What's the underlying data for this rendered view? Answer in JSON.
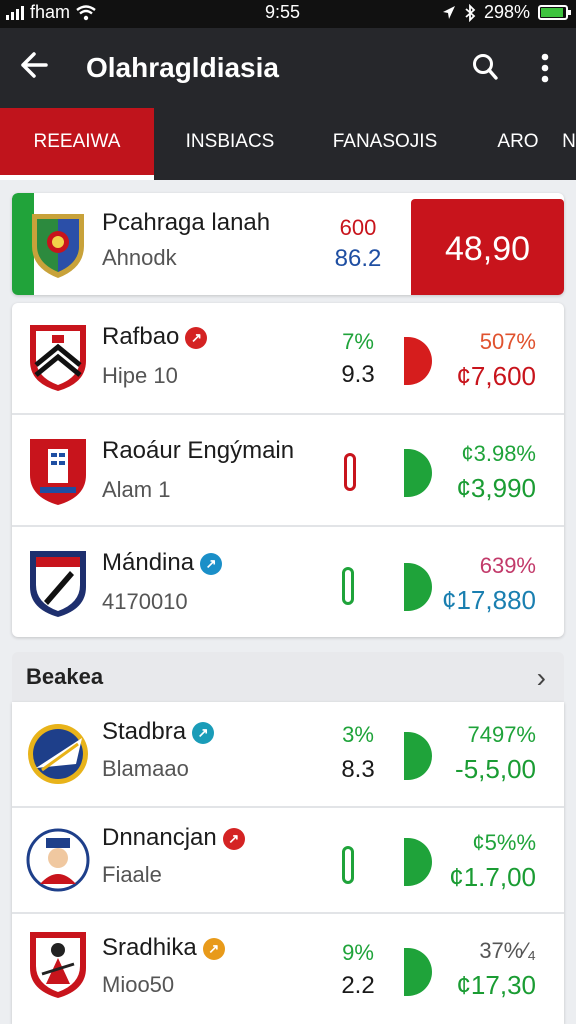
{
  "status_bar": {
    "carrier": "fham",
    "time": "9:55",
    "battery": "298%",
    "battery_level": 0.84
  },
  "app_bar": {
    "title": "Olahragldiasia"
  },
  "tabs": [
    {
      "label": "REEAIWA",
      "active": true
    },
    {
      "label": "INSBIACS",
      "active": false
    },
    {
      "label": "FANASOJIS",
      "active": false
    },
    {
      "label": "ARO",
      "active": false
    },
    {
      "label": "N",
      "active": false
    }
  ],
  "featured": {
    "name": "Pcahraga lanah",
    "sub": "Ahnodk",
    "odd_top": "600",
    "odd_bottom": "86.2",
    "price": "48,90"
  },
  "group1": [
    {
      "name": "Rafbao",
      "badge_color": "#d42323",
      "sub": "Hipe 10",
      "pct": "7%",
      "pct_color": "#1fa33a",
      "odd": "9.3",
      "indicator": "pill",
      "indicator_color": "#d61d1d",
      "rpct": "507%",
      "rpct_color": "#e0522e",
      "rprice": "¢7,600",
      "rprice_color": "#c8141c"
    },
    {
      "name": "Raoáur Engýmain",
      "sub": "Alam 1",
      "pct": "",
      "odd": "",
      "indicator": "vpill",
      "indicator_color": "#c8141c",
      "indicator2_color": "#1fa33a",
      "rpct": "¢3.98%",
      "rpct_color": "#1fa33a",
      "rprice": "¢3,990",
      "rprice_color": "#1a9c33"
    },
    {
      "name": "Mándina",
      "badge_color": "#1a8fc8",
      "sub": "4170010",
      "pct": "",
      "odd": "",
      "indicator": "vpill",
      "indicator_color": "#1fa33a",
      "indicator2_color": "#1fa33a",
      "rpct": "639%",
      "rpct_color": "#c23a6a",
      "rprice": "¢17,880",
      "rprice_color": "#1a7fb0"
    }
  ],
  "section": {
    "title": "Beakea"
  },
  "group2": [
    {
      "name": "Stadbra",
      "badge_color": "#1a9cb8",
      "sub": "Blamaao",
      "pct": "3%",
      "pct_color": "#1fa33a",
      "odd": "8.3",
      "indicator_color": "#1fa33a",
      "rpct": "7497%",
      "rpct_color": "#1fa33a",
      "rprice": "-5,5,00",
      "rprice_color": "#1a9c33"
    },
    {
      "name": "Dnnancjan",
      "badge_color": "#d42323",
      "sub": "Fiaale",
      "pct": "",
      "odd": "",
      "indicator_color": "#1fa33a",
      "rpct": "¢5%%",
      "rpct_color": "#1fa33a",
      "rprice": "¢1.7,00",
      "rprice_color": "#1a9c33"
    },
    {
      "name": "Sradhika",
      "badge_color": "#e89a1a",
      "sub": "Mioo50",
      "pct": "9%",
      "pct_color": "#1fa33a",
      "odd": "2.2",
      "indicator_color": "#1fa33a",
      "rpct": "37%⁄₄",
      "rpct_color": "#555555",
      "rprice": "¢17,30",
      "rprice_color": "#1a9c33"
    }
  ]
}
